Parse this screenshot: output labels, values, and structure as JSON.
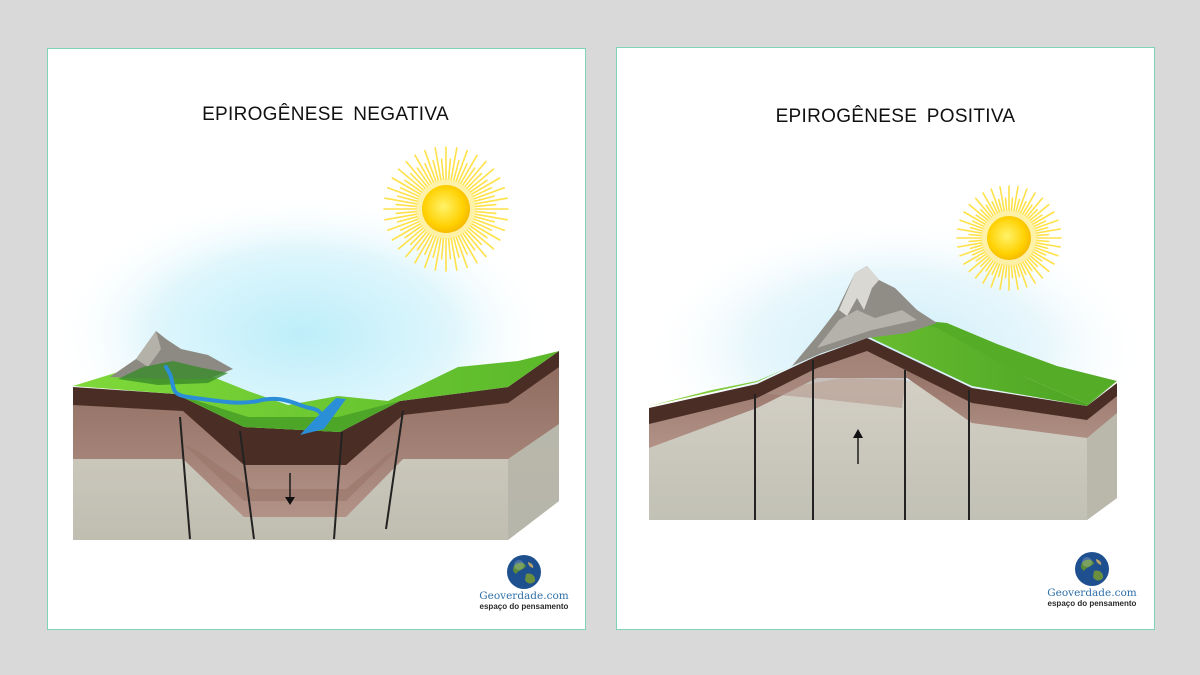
{
  "panels": {
    "left": {
      "title": "EPIROGÊNESE  NEGATIVA"
    },
    "right": {
      "title": "EPIROGÊNESE  POSITIVA"
    }
  },
  "logo": {
    "name": "Geoverdade.com",
    "tagline": "espaço do pensamento"
  },
  "colors": {
    "background": "#d9d9d9",
    "panel_border": "#7fd4b8",
    "grass": "#6cc32c",
    "soil": "#a8857a",
    "bedrock": "#c9c8bd",
    "sun": "#ffd400",
    "river": "#2a8fd6",
    "sky_glow": "#bdeaf7"
  }
}
